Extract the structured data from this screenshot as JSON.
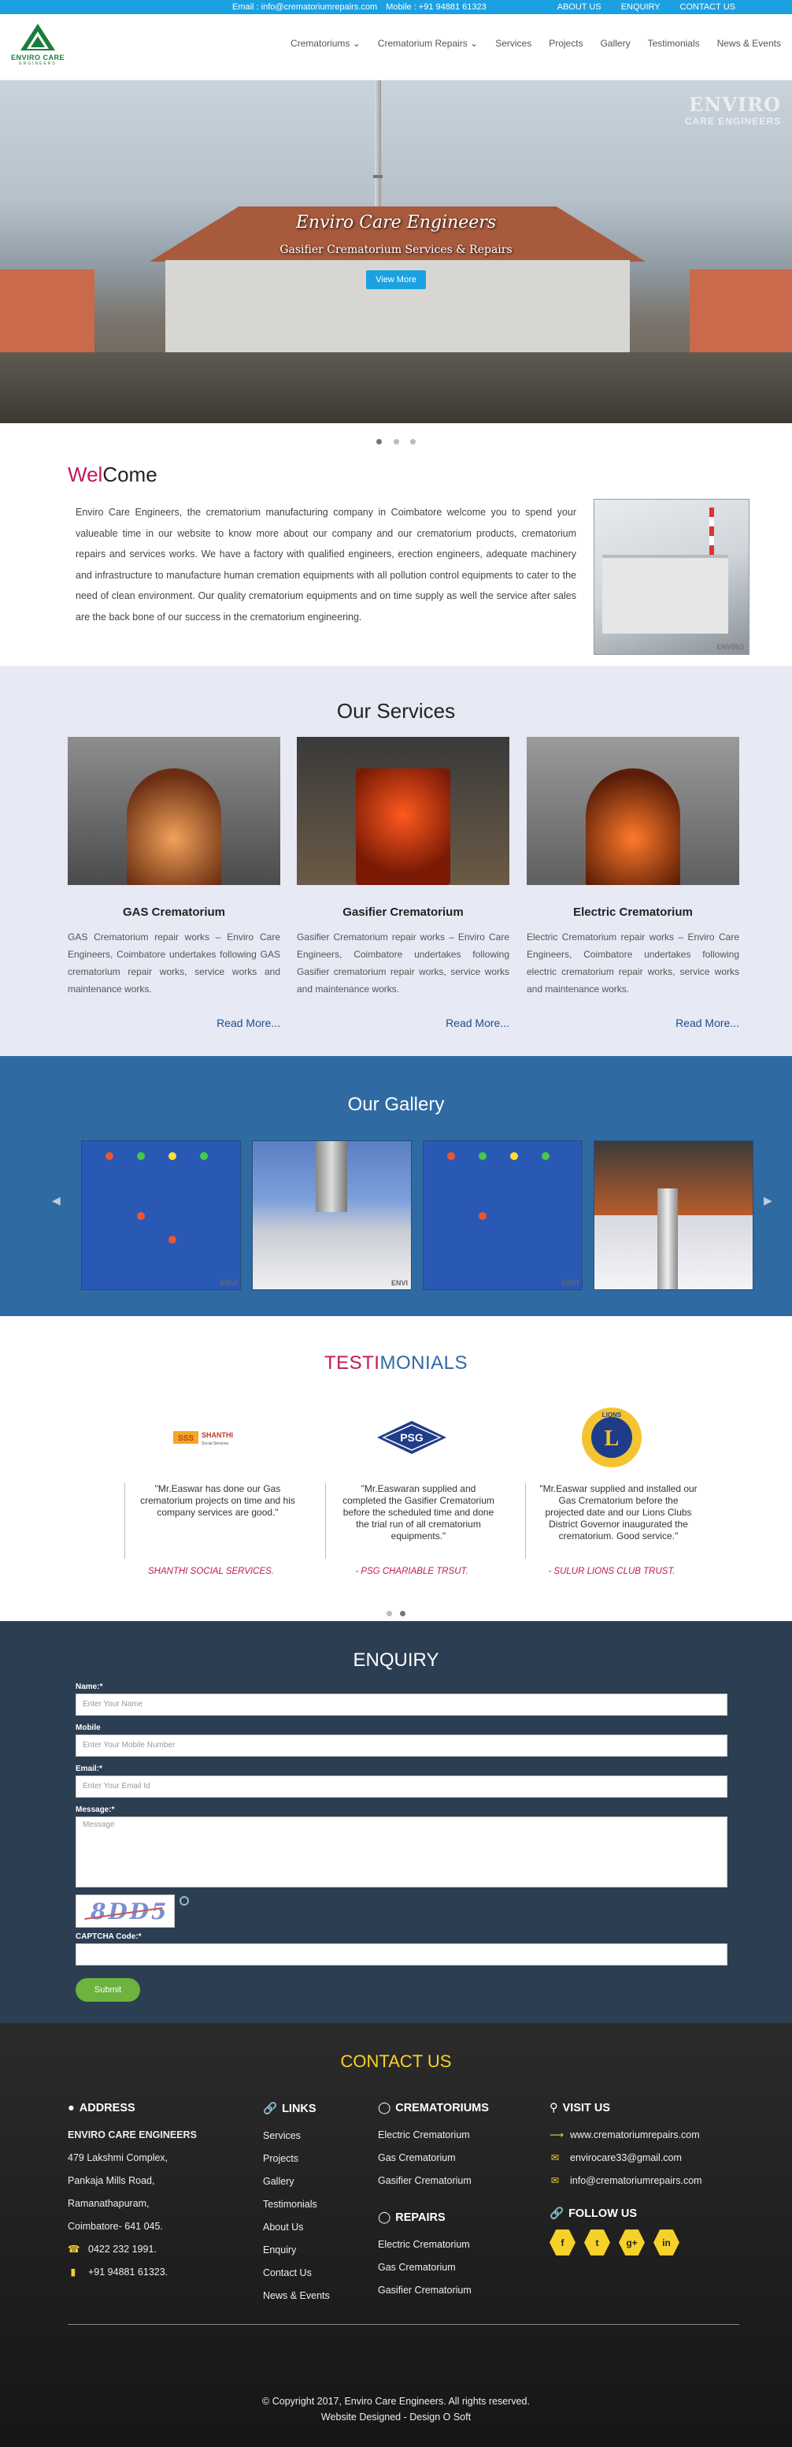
{
  "topbar": {
    "email": "Email : info@crematoriumrepairs.com",
    "mobile": "Mobile : +91 94881 61323",
    "links": [
      "ABOUT US",
      "ENQUIRY",
      "CONTACT US"
    ]
  },
  "logo": {
    "name": "ENVIRO CARE",
    "sub": "ENGINEERS"
  },
  "nav": [
    "Crematoriums ⌄",
    "Crematorium Repairs ⌄",
    "Services",
    "Projects",
    "Gallery",
    "Testimonials",
    "News & Events"
  ],
  "hero": {
    "watermark_1": "ENVIRO",
    "watermark_2": "CARE ENGINEERS",
    "title": "Enviro Care Engineers",
    "subtitle": "Gasifier Crematorium Services & Repairs",
    "button": "View More"
  },
  "welcome": {
    "title_red": "Wel",
    "title_rest": "Come",
    "text": "Enviro Care Engineers, the crematorium manufacturing company in Coimbatore welcome you to spend your valueable time in our website to know more about our company and our crematorium products, crematorium repairs and services works. We have a factory with qualified engineers, erection engineers, adequate machinery and infrastructure to manufacture human cremation equipments with all pollution control equipments to cater to the need of clean environment. Our quality crematorium equipments and on time supply as well the service after sales are the back bone of our success in the crematorium engineering.",
    "photo_watermark": "ENVIRO"
  },
  "services": {
    "title": "Our Services",
    "items": [
      {
        "title": "GAS Crematorium",
        "text": "GAS Crematorium repair works – Enviro Care Engineers, Coimbatore undertakes following GAS crematorium repair works, service works and maintenance works.",
        "more": "Read More..."
      },
      {
        "title": "Gasifier Crematorium",
        "text": "Gasifier Crematorium repair works – Enviro Care Engineers, Coimbatore undertakes following Gasifier crematorium repair works, service works and maintenance works.",
        "more": "Read More..."
      },
      {
        "title": "Electric Crematorium",
        "text": "Electric Crematorium repair works – Enviro Care Engineers, Coimbatore undertakes following electric crematorium repair works, service works and maintenance works.",
        "more": "Read More..."
      }
    ]
  },
  "gallery": {
    "title": "Our Gallery",
    "watermark": "ENVI"
  },
  "testimonials": {
    "title_red": "TESTI",
    "title_rest": "MONIALS",
    "items": [
      {
        "logo": "SSS SHANTHI",
        "quote": "\"Mr.Easwar has done our Gas crematorium projects on time and his company services are good.\"",
        "who": "SHANTHI SOCIAL SERVICES."
      },
      {
        "logo": "PSG",
        "quote": "\"Mr.Easwaran supplied and completed the Gasifier Crematorium before the scheduled time and done the trial run of all crematorium equipments.\"",
        "who": "- PSG CHARIABLE TRSUT."
      },
      {
        "logo": "LIONS",
        "quote": "\"Mr.Easwar supplied and installed our Gas Crematorium before the projected date and our Lions Clubs District Governor inaugurated the crematorium. Good service.\"",
        "who": "- SULUR LIONS CLUB TRUST."
      }
    ]
  },
  "enquiry": {
    "title": "ENQUIRY",
    "name_label": "Name:*",
    "name_placeholder": "Enter Your Name",
    "mobile_label": "Mobile",
    "mobile_placeholder": "Enter Your Mobile Number",
    "email_label": "Email:*",
    "email_placeholder": "Enter Your Email Id",
    "message_label": "Message:*",
    "message_placeholder": "Message",
    "captcha_text": "8DD5",
    "captcha_label": "CAPTCHA Code:*",
    "submit": "Submit"
  },
  "footer": {
    "title": "CONTACT US",
    "address": {
      "heading": "ADDRESS",
      "company": "ENVIRO CARE ENGINEERS",
      "lines": [
        "479 Lakshmi Complex,",
        "Pankaja Mills Road,",
        "Ramanathapuram,",
        "Coimbatore- 641 045."
      ],
      "phone": "0422 232 1991.",
      "mobile": "+91 94881 61323."
    },
    "links": {
      "heading": "LINKS",
      "items": [
        "Services",
        "Projects",
        "Gallery",
        "Testimonials",
        "About Us",
        "Enquiry",
        "Contact Us",
        "News & Events"
      ]
    },
    "crematoriums": {
      "heading": "CREMATORIUMS",
      "items": [
        "Electric Crematorium",
        "Gas Crematorium",
        "Gasifier Crematorium"
      ]
    },
    "repairs": {
      "heading": "REPAIRS",
      "items": [
        "Electric Crematorium",
        "Gas Crematorium",
        "Gasifier Crematorium"
      ]
    },
    "visit": {
      "heading": "VISIT US",
      "website": "www.crematoriumrepairs.com",
      "email1": "envirocare33@gmail.com",
      "email2": "info@crematoriumrepairs.com"
    },
    "follow": {
      "heading": "FOLLOW US",
      "icons": [
        "f",
        "t",
        "g+",
        "in"
      ]
    },
    "copyright": "© Copyright 2017, Enviro Care Engineers. All rights reserved.",
    "designed": "Website Designed - Design O Soft"
  },
  "colors": {
    "accent": "#1ba1e2",
    "brand_red": "#c2185b",
    "footer_yellow": "#f6d12a",
    "gallery_blue": "#2f6aa3",
    "enquiry_bg": "#2c3e52"
  }
}
